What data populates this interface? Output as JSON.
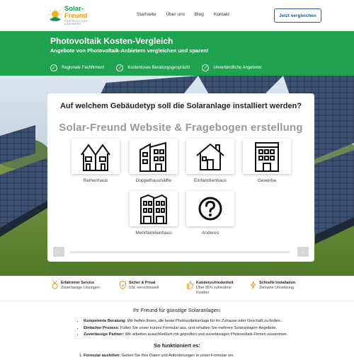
{
  "header": {
    "logo_name_part1": "Solar-",
    "logo_name_part2": "Freund",
    "logo_sub": "PHOTOVOLTAIK LÖSUNGEN",
    "nav": [
      "Startseite",
      "Über uns",
      "Blog",
      "Kontakt"
    ],
    "cta": "Jetzt vergleichen"
  },
  "banner": {
    "title": "Photovoltaik Kosten-Vergleich",
    "subtitle": "Angebote von Photovoltaik-Anbietern vergleichen und sparen!",
    "checks": [
      "Regionale Fachfirmen!",
      "Kostenloses Beratungsgespräch!",
      "Unverbindliche Angebote!"
    ]
  },
  "form": {
    "question": "Auf welchem Gebäudetyp soll die Solaranlage installiert werden?",
    "watermark": "Solar-Freund Website & Fragebogen erstellung",
    "options": [
      {
        "label": "Reihenhaus",
        "icon": "row-house-icon"
      },
      {
        "label": "Doppelhaushälfte",
        "icon": "semi-detached-house-icon"
      },
      {
        "label": "Einfamilienhaus",
        "icon": "detached-house-icon"
      },
      {
        "label": "Gewerbe",
        "icon": "commercial-building-icon"
      },
      {
        "label": "Mehrfamilienhaus",
        "icon": "apartment-building-icon"
      },
      {
        "label": "Anderes",
        "icon": "question-mark-icon"
      }
    ],
    "prev": "←",
    "next": "→"
  },
  "features": [
    {
      "title": "Erfahrener Service",
      "text": "Zuverlässige Lösungen",
      "icon": "medal-icon"
    },
    {
      "title": "Sicher & Privat",
      "text": "SSL-verschlüsselt",
      "icon": "shield-check-icon"
    },
    {
      "title": "Kundenzufriedenheit",
      "text": "Über 95% zufriedene Kunden",
      "icon": "thumbs-up-icon"
    },
    {
      "title": "Schnelle Installation",
      "text": "Zeitnahe Umsetzung",
      "icon": "lightning-icon"
    }
  ],
  "content": {
    "title": "Ihr Freund für günstige Solaranlagen:",
    "benefits": [
      {
        "bold": "Kompetente Beratung:",
        "text": " Wir helfen Ihnen, die beste Photovoltaikanlage für Ihr Zuhause oder Geschäft zu finden."
      },
      {
        "bold": "Einfacher Prozess:",
        "text": " Füllen Sie unser kurzes Formular aus, und erhalten Sie mehrere Solaranlagen-Angebote."
      },
      {
        "bold": "Zuverlässige Partner:",
        "text": " Wir arbeiten ausschließlich mit geprüften und zuverlässigen Photovoltaik-Firmen zusammen."
      }
    ],
    "howto_title": "So funktioniert es:",
    "steps": [
      {
        "bold": "Formular ausfüllen:",
        "text": " Geben Sie Ihre Daten und Anforderungen in unser Formular ein."
      }
    ]
  },
  "colors": {
    "brand_green": "#1fa34f",
    "brand_blue": "#1e5aa8",
    "brand_orange": "#e89a1a"
  }
}
